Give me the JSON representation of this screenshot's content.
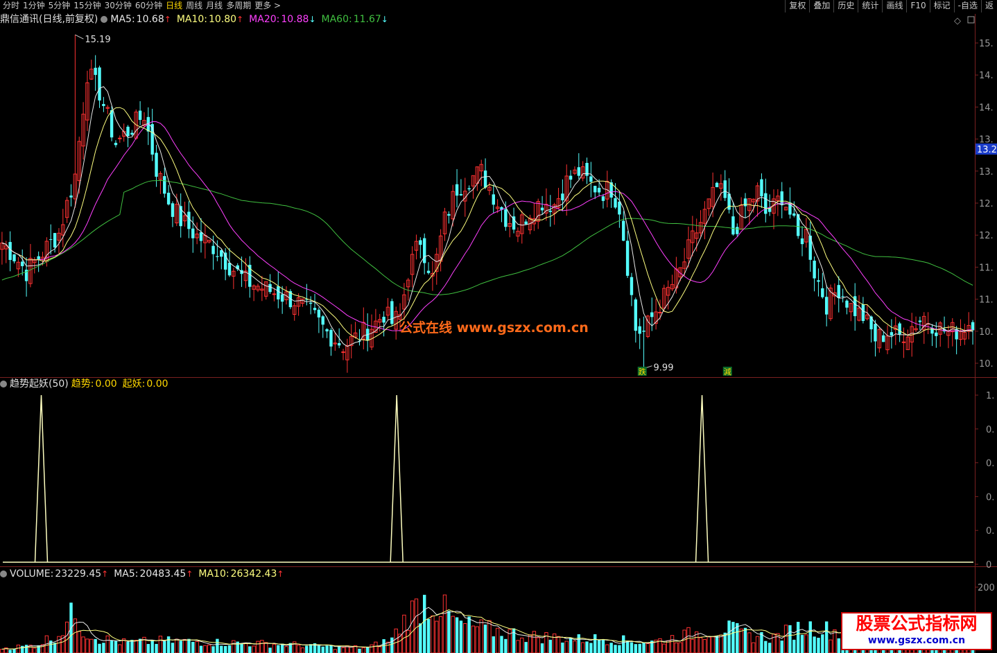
{
  "toolbar": {
    "periods": [
      "分时",
      "1分钟",
      "5分钟",
      "15分钟",
      "30分钟",
      "60分钟",
      "日线",
      "周线",
      "月线",
      "多周期",
      "更多 >"
    ],
    "active_period": "日线",
    "tools": [
      "复权",
      "叠加",
      "历史",
      "统计",
      "画线",
      "F10",
      "标记",
      "-自选",
      "返"
    ]
  },
  "main_legend": {
    "title": "鼎信通讯(日线,前复权)",
    "ma5_label": "MA5:",
    "ma5_value": "10.68",
    "ma10_label": "MA10:",
    "ma10_value": "10.80",
    "ma20_label": "MA20:",
    "ma20_value": "10.88",
    "ma60_label": "MA60:",
    "ma60_value": "11.67",
    "up_arrow": "↑",
    "down_arrow": "↓"
  },
  "indicator_legend": {
    "title": "趋势起妖(50)",
    "trend_label": "趋势:",
    "trend_value": "0.00",
    "yao_label": "起妖:",
    "yao_value": "0.00"
  },
  "volume_legend": {
    "title": "VOLUME:",
    "value": "23229.45",
    "ma5_label": "MA5:",
    "ma5_value": "20483.45",
    "ma10_label": "MA10:",
    "ma10_value": "26342.43",
    "up_arrow": "↑"
  },
  "watermarks": {
    "center": "公式在线  www.gszx.com.cn",
    "corner_title": "股票公式指标网",
    "corner_url": "www.gszx.com.cn"
  },
  "markers": {
    "marker1": "跌",
    "marker2": "減"
  },
  "colors": {
    "up": "#ff3232",
    "down": "#54ffff",
    "ma5": "#e8e8e8",
    "ma10": "#ffff80",
    "ma20": "#ff40ff",
    "ma60": "#40c040",
    "indicator": "#ffffc0",
    "accent_yellow": "#ffd800"
  },
  "chart_data": [
    {
      "type": "candlestick",
      "title": "鼎信通讯(日线,前复权)",
      "y_ticks": [
        "15.",
        "14.",
        "14.",
        "13.",
        "13.",
        "12.",
        "12.",
        "11.",
        "11.",
        "10.",
        "10."
      ],
      "current_price_tag": "13.2",
      "ylim": [
        9.9,
        15.3
      ],
      "high_annotation": "15.19",
      "low_annotation": "9.99",
      "high": 15.19,
      "low": 9.99,
      "anchors": [
        [
          0,
          11.95
        ],
        [
          3,
          11.75
        ],
        [
          6,
          11.5
        ],
        [
          10,
          11.8
        ],
        [
          14,
          12.1
        ],
        [
          18,
          13.0
        ],
        [
          21,
          14.6
        ],
        [
          24,
          14.3
        ],
        [
          28,
          13.5
        ],
        [
          32,
          13.75
        ],
        [
          35,
          13.95
        ],
        [
          38,
          13.1
        ],
        [
          41,
          12.6
        ],
        [
          44,
          12.3
        ],
        [
          48,
          12.05
        ],
        [
          52,
          11.9
        ],
        [
          56,
          11.6
        ],
        [
          60,
          11.35
        ],
        [
          64,
          11.25
        ],
        [
          68,
          11.15
        ],
        [
          72,
          11.05
        ],
        [
          76,
          10.85
        ],
        [
          80,
          10.55
        ],
        [
          84,
          10.35
        ],
        [
          88,
          10.5
        ],
        [
          92,
          10.7
        ],
        [
          94,
          10.85
        ],
        [
          96,
          10.7
        ],
        [
          98,
          10.8
        ],
        [
          100,
          11.5
        ],
        [
          103,
          12.0
        ],
        [
          106,
          11.4
        ],
        [
          109,
          12.3
        ],
        [
          112,
          12.8
        ],
        [
          115,
          12.95
        ],
        [
          118,
          13.05
        ],
        [
          121,
          12.7
        ],
        [
          124,
          12.35
        ],
        [
          127,
          12.2
        ],
        [
          130,
          12.45
        ],
        [
          133,
          12.6
        ],
        [
          136,
          12.55
        ],
        [
          139,
          12.9
        ],
        [
          142,
          13.05
        ],
        [
          145,
          12.85
        ],
        [
          148,
          12.75
        ],
        [
          150,
          12.8
        ],
        [
          152,
          12.5
        ],
        [
          154,
          11.6
        ],
        [
          156,
          10.6
        ],
        [
          158,
          10.55
        ],
        [
          161,
          10.9
        ],
        [
          164,
          11.2
        ],
        [
          167,
          11.5
        ],
        [
          170,
          12.0
        ],
        [
          173,
          12.4
        ],
        [
          176,
          12.8
        ],
        [
          178,
          12.6
        ],
        [
          180,
          12.1
        ],
        [
          183,
          12.5
        ],
        [
          186,
          12.75
        ],
        [
          188,
          12.4
        ],
        [
          190,
          12.5
        ],
        [
          192,
          12.7
        ],
        [
          194,
          12.4
        ],
        [
          196,
          12.0
        ],
        [
          198,
          12.1
        ],
        [
          200,
          11.5
        ],
        [
          203,
          11.0
        ],
        [
          206,
          11.25
        ],
        [
          209,
          10.95
        ],
        [
          212,
          10.8
        ],
        [
          215,
          10.45
        ],
        [
          218,
          10.55
        ],
        [
          221,
          10.5
        ],
        [
          224,
          10.65
        ],
        [
          227,
          10.8
        ],
        [
          230,
          10.65
        ],
        [
          233,
          10.55
        ],
        [
          236,
          10.6
        ],
        [
          239,
          10.75
        ]
      ]
    },
    {
      "type": "line",
      "title": "趋势起妖(50)",
      "y_ticks": [
        "1.",
        "0.",
        "0.",
        "0.",
        "0.",
        "0"
      ],
      "ylim": [
        -0.1,
        1.0
      ],
      "series": [
        {
          "name": "起妖",
          "spikes_at_bar": [
            10,
            97,
            172
          ],
          "value": 1.0,
          "baseline": 0
        }
      ]
    },
    {
      "type": "bar",
      "title": "VOLUME",
      "y_ticks": [
        "200"
      ],
      "ylim": [
        0,
        220000
      ],
      "volume_anchors": [
        [
          0,
          14000
        ],
        [
          8,
          22000
        ],
        [
          14,
          55000
        ],
        [
          18,
          120000
        ],
        [
          20,
          65000
        ],
        [
          24,
          42000
        ],
        [
          30,
          30000
        ],
        [
          40,
          35000
        ],
        [
          50,
          32000
        ],
        [
          60,
          28000
        ],
        [
          70,
          25000
        ],
        [
          80,
          18000
        ],
        [
          90,
          15000
        ],
        [
          96,
          40000
        ],
        [
          100,
          110000
        ],
        [
          104,
          150000
        ],
        [
          108,
          130000
        ],
        [
          112,
          85000
        ],
        [
          118,
          70000
        ],
        [
          124,
          60000
        ],
        [
          130,
          48000
        ],
        [
          136,
          45000
        ],
        [
          142,
          40000
        ],
        [
          148,
          42000
        ],
        [
          154,
          35000
        ],
        [
          160,
          32000
        ],
        [
          166,
          45000
        ],
        [
          172,
          60000
        ],
        [
          178,
          72000
        ],
        [
          184,
          50000
        ],
        [
          190,
          45000
        ],
        [
          196,
          70000
        ],
        [
          200,
          75000
        ],
        [
          206,
          60000
        ],
        [
          212,
          45000
        ],
        [
          218,
          35000
        ],
        [
          224,
          30000
        ],
        [
          232,
          25000
        ],
        [
          239,
          23229
        ]
      ]
    }
  ]
}
